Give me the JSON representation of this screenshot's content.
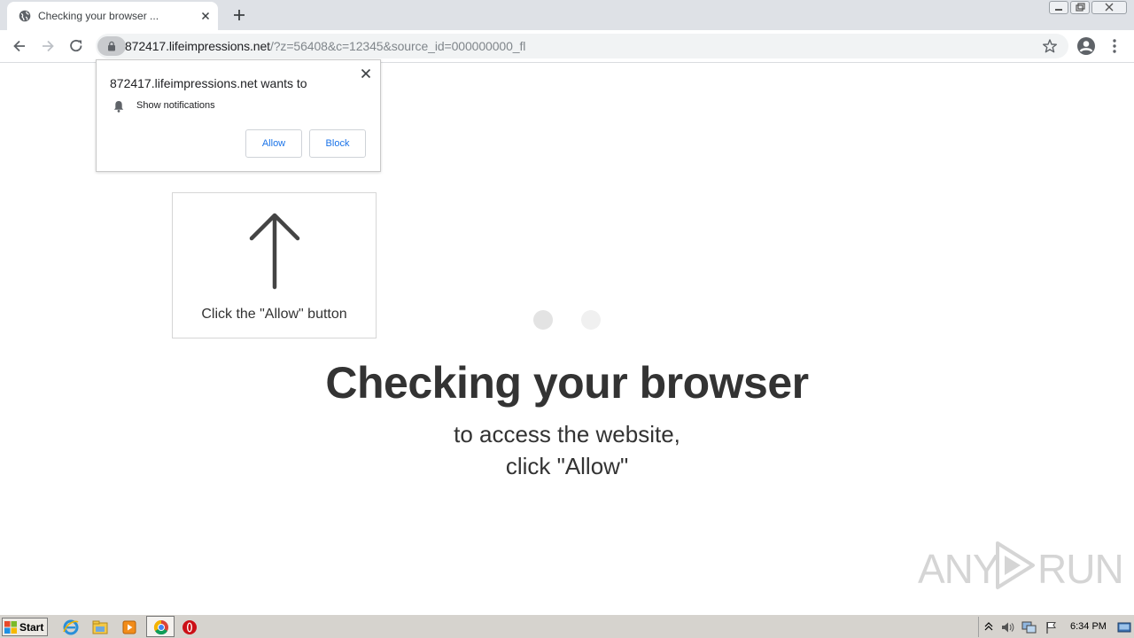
{
  "browser": {
    "tab": {
      "title": "Checking your browser ..."
    },
    "address": {
      "host": "872417.lifeimpressions.net",
      "path": "/?z=56408&c=12345&source_id=000000000_fl"
    }
  },
  "permission_prompt": {
    "title": "872417.lifeimpressions.net wants to",
    "permission_label": "Show notifications",
    "allow_label": "Allow",
    "block_label": "Block"
  },
  "page": {
    "hint_text": "Click the \"Allow\" button",
    "headline": "Checking your browser",
    "subline_1": "to access the website,",
    "subline_2": "click \"Allow\""
  },
  "watermark": {
    "left": "ANY",
    "right": "RUN"
  },
  "taskbar": {
    "start_label": "Start",
    "clock": "6:34 PM"
  },
  "colors": {
    "accent": "#1a73e8",
    "tabstrip": "#dee1e6",
    "headline": "#333333"
  }
}
